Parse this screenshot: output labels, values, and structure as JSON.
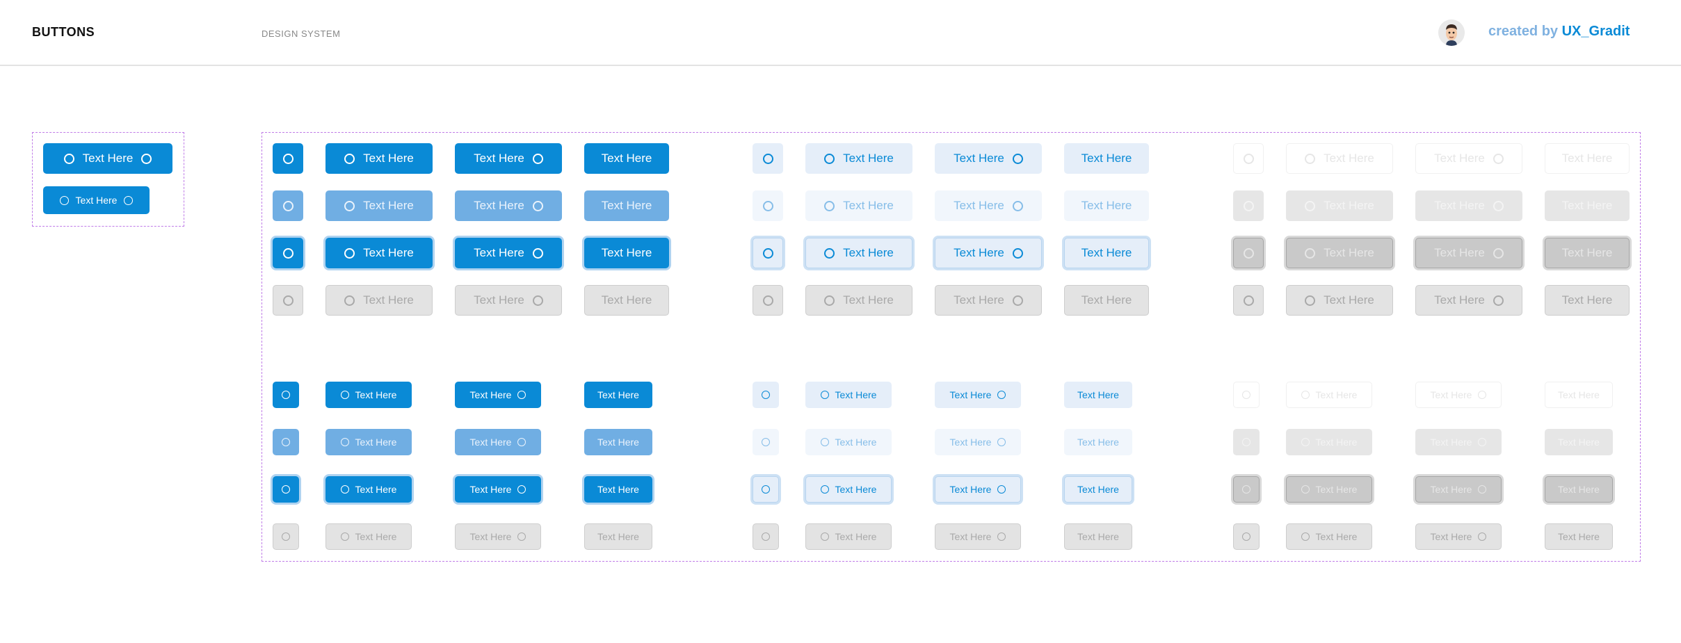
{
  "header": {
    "title": "BUTTONS",
    "subtitle": "DESIGN SYSTEM",
    "credit_prefix": "created by ",
    "credit_brand": "UX_Gradit"
  },
  "button_label": "Text Here",
  "icon_name": "circle-icon",
  "variants": [
    "primary",
    "secondary",
    "tertiary"
  ],
  "states": [
    "default",
    "hover",
    "focused",
    "disabled"
  ],
  "layouts": [
    "icon-only",
    "icon-left",
    "icon-right",
    "text-only"
  ],
  "colors": {
    "primary": "#0a8ad6",
    "primary_hover": "#70aee3",
    "secondary_bg": "#e5eef9",
    "disabled_bg": "#e3e3e3",
    "disabled_text": "#a9a9a9",
    "frame": "#c07ce8"
  }
}
